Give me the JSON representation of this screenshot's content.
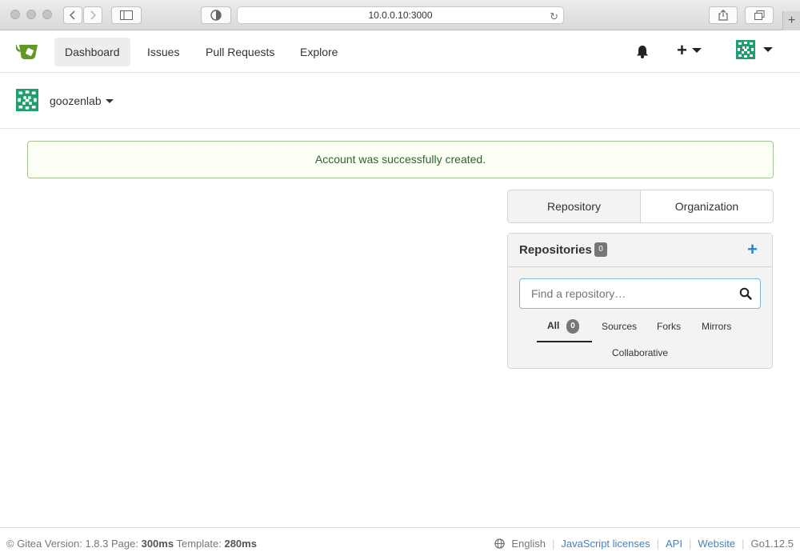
{
  "browser": {
    "url": "10.0.0.10:3000"
  },
  "nav": {
    "items": [
      {
        "label": "Dashboard"
      },
      {
        "label": "Issues"
      },
      {
        "label": "Pull Requests"
      },
      {
        "label": "Explore"
      }
    ]
  },
  "context": {
    "username": "goozenlab"
  },
  "flash": {
    "message": "Account was successfully created."
  },
  "switcher": {
    "repository": "Repository",
    "organization": "Organization"
  },
  "repos": {
    "title": "Repositories",
    "count": "0",
    "search_placeholder": "Find a repository…",
    "filters": {
      "all": "All",
      "all_count": "0",
      "sources": "Sources",
      "forks": "Forks",
      "mirrors": "Mirrors",
      "collaborative": "Collaborative"
    }
  },
  "footer": {
    "version_prefix": "© Gitea Version: 1.8.3 Page:",
    "page_time": "300ms",
    "template_label": "Template:",
    "template_time": "280ms",
    "language": "English",
    "js_licenses": "JavaScript licenses",
    "api": "API",
    "website": "Website",
    "go_version": "Go1.12.5"
  },
  "colors": {
    "accent": "#2185d0",
    "gitea_green": "#609926",
    "success_text": "#2c662d"
  }
}
